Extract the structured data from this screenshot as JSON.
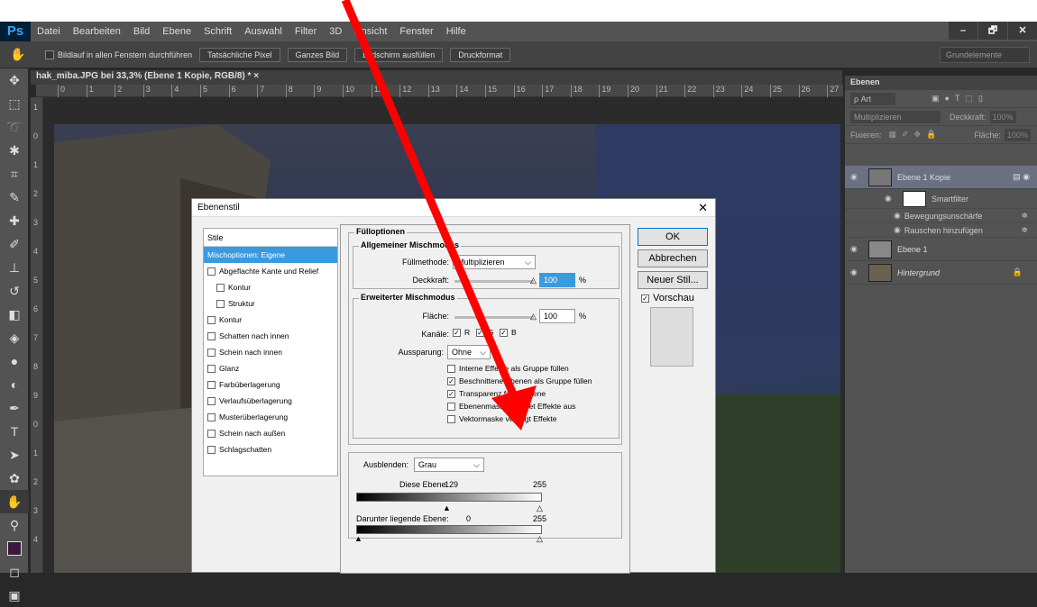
{
  "app": {
    "logo": "Ps",
    "menu": [
      "Datei",
      "Bearbeiten",
      "Bild",
      "Ebene",
      "Schrift",
      "Auswahl",
      "Filter",
      "3D",
      "Ansicht",
      "Fenster",
      "Hilfe"
    ],
    "win": [
      "–",
      "🗗",
      "✕"
    ]
  },
  "options": {
    "scroll_all": "Bildlauf in allen Fenstern durchführen",
    "buttons": [
      "Tatsächliche Pixel",
      "Ganzes Bild",
      "Bildschirm ausfüllen",
      "Druckformat"
    ],
    "workspace": "Grundelemente"
  },
  "document": {
    "tab": "hak_miba.JPG bei 33,3% (Ebene 1 Kopie, RGB/8) * ×",
    "ruler": [
      "0",
      "1",
      "2",
      "3",
      "4",
      "5",
      "6",
      "7",
      "8",
      "9",
      "10",
      "11",
      "12",
      "13",
      "14",
      "15",
      "16",
      "17",
      "18",
      "19",
      "20",
      "21",
      "22",
      "23",
      "24",
      "25",
      "26",
      "27"
    ],
    "vruler": [
      "1",
      "0",
      "1",
      "2",
      "3",
      "4",
      "5",
      "6",
      "7",
      "8",
      "9",
      "0",
      "1",
      "2",
      "3",
      "4"
    ]
  },
  "layers": {
    "tab": "Ebenen",
    "filter": "ρ Art",
    "blend": "Multiplizieren",
    "opacity_label": "Deckkraft:",
    "opacity": "100%",
    "lock_label": "Fixieren:",
    "fill_label": "Fläche:",
    "fill": "100%",
    "items": [
      {
        "name": "Ebene 1 Kopie"
      },
      {
        "name": "Smartfilter"
      },
      {
        "name": "Bewegungsunschärfe"
      },
      {
        "name": "Rauschen hinzufügen"
      },
      {
        "name": "Ebene 1"
      },
      {
        "name": "Hintergrund"
      }
    ]
  },
  "dialog": {
    "title": "Ebenenstil",
    "styles_header": "Stile",
    "styles": [
      "Mischoptionen: Eigene",
      "Abgeflachte Kante und Relief",
      "Kontur",
      "Struktur",
      "Kontur",
      "Schatten nach innen",
      "Schein nach innen",
      "Glanz",
      "Farbüberlagerung",
      "Verlaufsüberlagerung",
      "Musterüberlagerung",
      "Schein nach außen",
      "Schlagschatten"
    ],
    "fill_options": "Fülloptionen",
    "general": "Allgemeiner Mischmodus",
    "fill_method_label": "Füllmethode:",
    "fill_method": "Multiplizieren",
    "opacity_label": "Deckkraft:",
    "opacity": "100",
    "pct": "%",
    "advanced": "Erweiterter Mischmodus",
    "area_label": "Fläche:",
    "area": "100",
    "channels_label": "Kanäle:",
    "ch": [
      "R",
      "G",
      "B"
    ],
    "knockout_label": "Aussparung:",
    "knockout": "Ohne",
    "checks": [
      "Interne Effekte als Gruppe füllen",
      "Beschnittene Ebenen als Gruppe füllen",
      "Transparenz formt Ebene",
      "Ebenenmaske blendet Effekte aus",
      "Vektormaske verbirgt Effekte"
    ],
    "blend_if_label": "Ausblenden:",
    "blend_if": "Grau",
    "this_layer": "Diese Ebene:",
    "this_lo": "129",
    "this_hi": "255",
    "under_layer": "Darunter liegende Ebene:",
    "under_lo": "0",
    "under_hi": "255",
    "ok": "OK",
    "cancel": "Abbrechen",
    "new_style": "Neuer Stil...",
    "preview": "Vorschau"
  }
}
